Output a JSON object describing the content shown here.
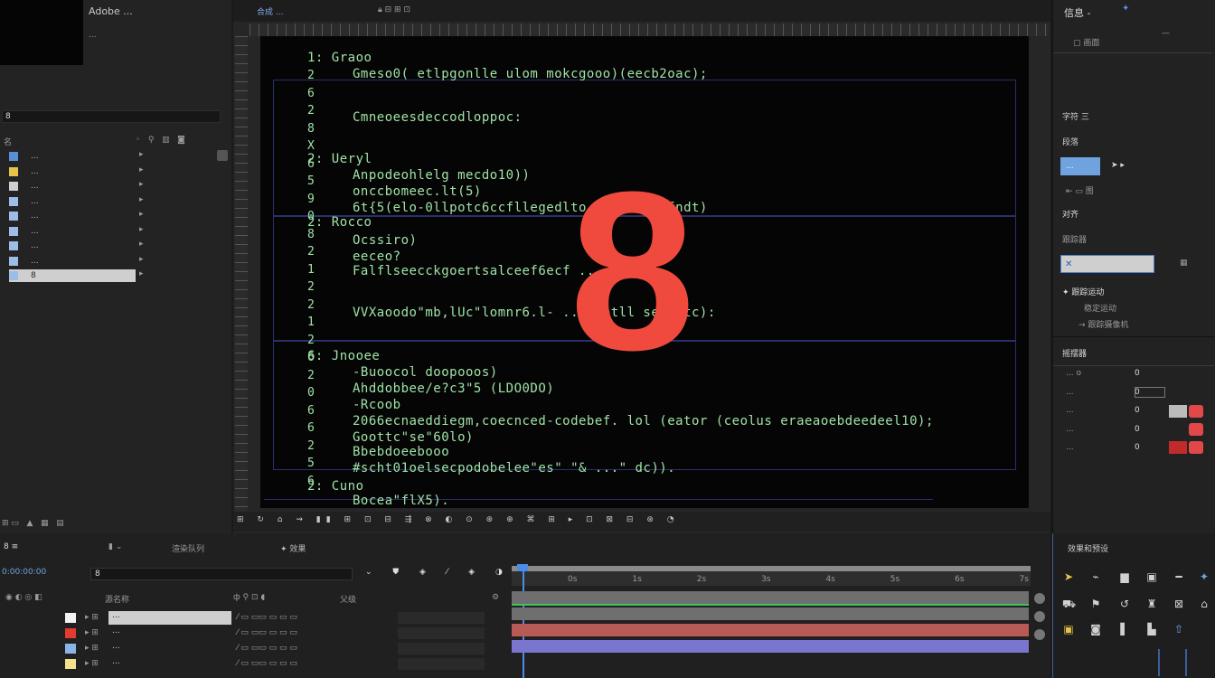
{
  "project": {
    "app_title": "Adobe ...",
    "item_name": "...",
    "search_value": "8",
    "header_label": "名",
    "items": [
      {
        "label": "...",
        "color": "#5a8fd6"
      },
      {
        "label": "...",
        "color": "#e8c34a"
      },
      {
        "label": "...",
        "color": "#cfcfcf"
      },
      {
        "label": "...",
        "color": "#9bbde6"
      },
      {
        "label": "...",
        "color": "#9bbde6"
      },
      {
        "label": "...",
        "color": "#9bbde6"
      },
      {
        "label": "...",
        "color": "#9bbde6"
      },
      {
        "label": "...",
        "color": "#9bbde6"
      },
      {
        "label": "8",
        "color": "#9bbde6"
      }
    ]
  },
  "viewer": {
    "tab_label": "合成 ...",
    "code_lines": [
      "Gmeso0( etlpgonlle ulom mokcgooo)(eecb2oac);",
      "Cmneoeesdeccodloppoc:",
      "Anpodeohlelg mecdo10))",
      "onccbomeec.lt(5)",
      "6t{5(elo-0llpotc6ccfllegedlto ... ollacfndt)",
      "Ocssiro)",
      "eeceo?",
      "Falflseecckgoertsalceef6ecf ...",
      "VVXaoodo\"mb,lUc\"lomnr6.l- ... potll seftitc):",
      "-Buoocol doopooos)",
      "Ahddobbee/e?c3\"5 (LDO0DO)",
      "-Rcoob",
      "2066ecnaeddiegm,coecnced-codebef. lol (eator (ceolus eraeaoebdeedeel10);",
      "Goottc\"se\"60lo)",
      "Bbebdoeebooo",
      "#scht01oelsecpodobelee\"es\" \"& ...\" dc)).",
      "Bocea\"flX5)."
    ],
    "labels": [
      "1: Graoo",
      "2: Ueryl",
      "2: Rocco",
      "6: Jnooee",
      "2: Cuno"
    ],
    "line_numbers": [
      "2",
      "6",
      "2",
      "8",
      "X",
      "6",
      "5",
      "9",
      "0",
      "8",
      "2",
      "1",
      "2",
      "2",
      "1",
      "2",
      "6",
      "2",
      "0",
      "6",
      "6",
      "2",
      "5",
      "6"
    ],
    "big_number": "8",
    "zoom": "..."
  },
  "right_panel": {
    "header": "信息 -",
    "sections": [
      "字符 三",
      "段落",
      "对齐",
      "跟踪器",
      "摇摆器"
    ],
    "value_field": "...",
    "rows": [
      {
        "label": "... o",
        "value": "0"
      },
      {
        "label": "...",
        "value": "0"
      },
      {
        "label": "...",
        "value": "0"
      },
      {
        "label": "...",
        "value": "0"
      },
      {
        "label": "...",
        "value": "0"
      }
    ]
  },
  "timeline": {
    "tab": "8 ≡",
    "render_queue": "渲染队列",
    "search_value": "8",
    "column_source": "源名称",
    "column_parent": "父级",
    "layers": [
      {
        "name": "...",
        "color": "#f3f3f3"
      },
      {
        "name": "...",
        "color": "#e33b2f"
      },
      {
        "name": "...",
        "color": "#8ab4e8"
      },
      {
        "name": "...",
        "color": "#f5e08c"
      }
    ],
    "bar_colors": [
      "#6f6f6f",
      "#6f6f6f",
      "#b85a55",
      "#7a76cf"
    ]
  },
  "effects": {
    "title": "效果和预设"
  }
}
